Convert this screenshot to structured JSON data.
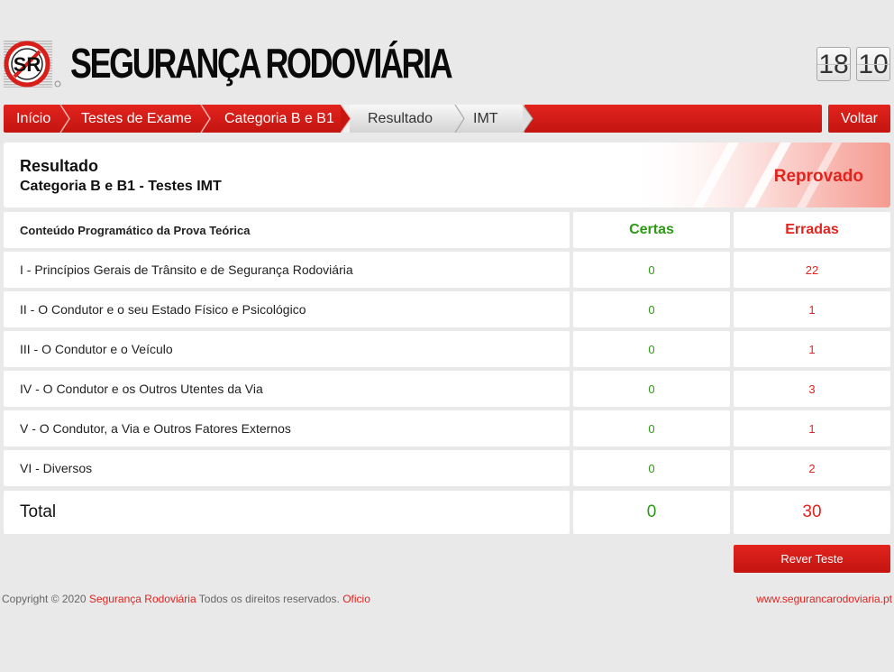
{
  "header": {
    "logo_letters": "SR",
    "brand": "SEGURANÇA RODOVIÁRIA",
    "clock_hours": "18",
    "clock_minutes": "10"
  },
  "breadcrumb": {
    "items": [
      "Início",
      "Testes de Exame",
      "Categoria B e B1",
      "Resultado",
      "IMT"
    ],
    "back_label": "Voltar"
  },
  "result": {
    "title": "Resultado",
    "subtitle": "Categoria B e B1 - Testes IMT",
    "status": "Reprovado"
  },
  "table": {
    "header": {
      "label": "Conteúdo Programático da Prova Teórica",
      "correct": "Certas",
      "wrong": "Erradas"
    },
    "rows": [
      {
        "label": "I - Princípios Gerais de Trânsito e de Segurança Rodoviária",
        "correct": "0",
        "wrong": "22"
      },
      {
        "label": "II - O Condutor e o seu Estado Físico e Psicológico",
        "correct": "0",
        "wrong": "1"
      },
      {
        "label": "III - O Condutor e o Veículo",
        "correct": "0",
        "wrong": "1"
      },
      {
        "label": "IV - O Condutor e os Outros Utentes da Via",
        "correct": "0",
        "wrong": "3"
      },
      {
        "label": "V - O Condutor, a Via e Outros Fatores Externos",
        "correct": "0",
        "wrong": "1"
      },
      {
        "label": "VI - Diversos",
        "correct": "0",
        "wrong": "2"
      }
    ],
    "total": {
      "label": "Total",
      "correct": "0",
      "wrong": "30"
    }
  },
  "actions": {
    "review_label": "Rever Teste"
  },
  "footer": {
    "copyright": "Copyright © 2020",
    "brand_link": "Segurança Rodoviária",
    "rights": "Todos os direitos reservados.",
    "office_link": "Oficio",
    "site": "www.segurancarodoviaria.pt"
  },
  "colors": {
    "accent_red": "#e3231e",
    "correct_green": "#2a9a12",
    "background": "#e9e9e9"
  }
}
